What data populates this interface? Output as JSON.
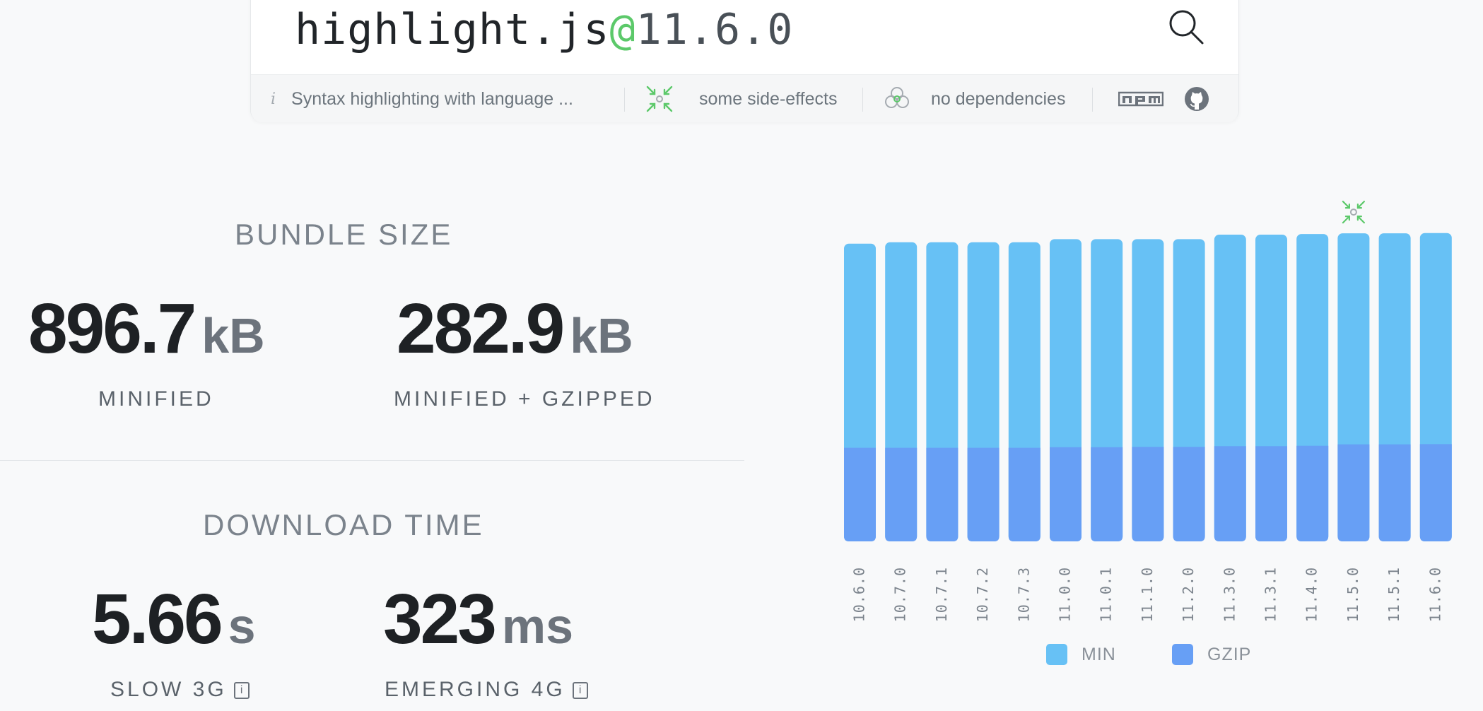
{
  "search": {
    "package_name": "highlight.js",
    "at_sign": "@",
    "version": "11.6.0"
  },
  "meta": {
    "description": "Syntax highlighting with language ...",
    "side_effects": "some side-effects",
    "dependencies": "no dependencies",
    "icons": [
      "info-icon",
      "side-effects-icon",
      "dependencies-icon",
      "npm-icon",
      "github-icon"
    ]
  },
  "bundle": {
    "title": "BUNDLE SIZE",
    "minified": {
      "value": "896.7",
      "unit": "kB",
      "label": "MINIFIED"
    },
    "gzipped": {
      "value": "282.9",
      "unit": "kB",
      "label": "MINIFIED + GZIPPED"
    }
  },
  "download": {
    "title": "DOWNLOAD TIME",
    "slow3g": {
      "value": "5.66",
      "unit": "s",
      "label": "SLOW 3G"
    },
    "emerging4g": {
      "value": "323",
      "unit": "ms",
      "label": "EMERGING 4G"
    },
    "info_glyph": "i"
  },
  "colors": {
    "min": "#67c1f5",
    "gzip": "#679ff5",
    "accent": "#5cc96a"
  },
  "chart_data": {
    "type": "bar",
    "stacked": true,
    "categories": [
      "10.6.0",
      "10.7.0",
      "10.7.1",
      "10.7.2",
      "10.7.3",
      "11.0.0",
      "11.0.1",
      "11.1.0",
      "11.2.0",
      "11.3.0",
      "11.3.1",
      "11.4.0",
      "11.5.0",
      "11.5.1",
      "11.6.0"
    ],
    "series": [
      {
        "name": "MIN",
        "values": [
          866,
          870,
          870,
          870,
          870,
          879,
          879,
          879,
          879,
          892,
          892,
          894,
          896,
          896,
          896.7
        ]
      },
      {
        "name": "GZIP",
        "values": [
          272,
          272,
          272,
          272,
          272,
          274,
          274,
          275,
          275,
          277,
          277,
          278,
          282,
          282,
          282.9
        ]
      }
    ],
    "marked_category": "11.5.0",
    "legend": [
      "MIN",
      "GZIP"
    ],
    "legend_position": "bottom"
  }
}
